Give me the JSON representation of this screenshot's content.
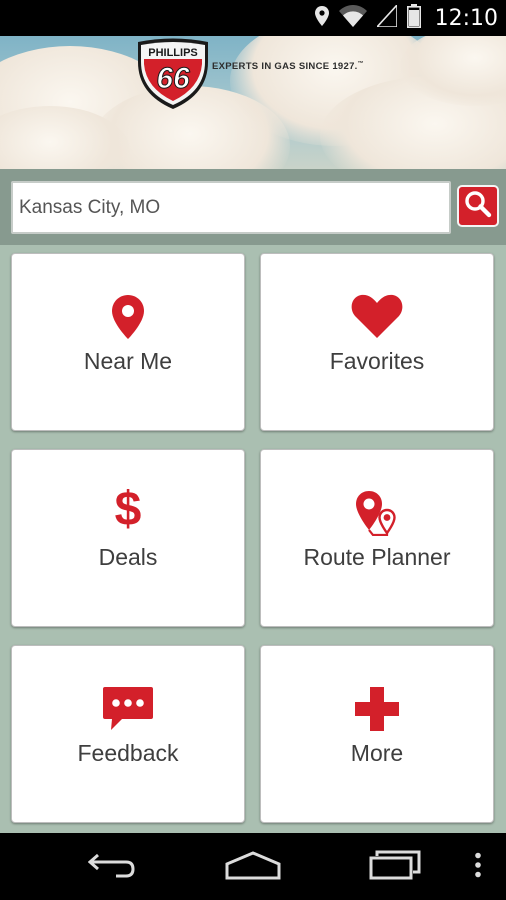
{
  "status_bar": {
    "time": "12:10",
    "icons": [
      "location-icon",
      "wifi-icon",
      "signal-icon",
      "battery-icon"
    ]
  },
  "header": {
    "brand_text": "PHILLIPS",
    "brand_number": "66",
    "tagline": "EXPERTS IN GAS SINCE 1927.",
    "tagline_mark": "™"
  },
  "search": {
    "value": "Kansas City, MO",
    "button_icon": "search-icon"
  },
  "tiles": [
    {
      "label": "Near Me",
      "icon": "map-pin-icon"
    },
    {
      "label": "Favorites",
      "icon": "heart-icon"
    },
    {
      "label": "Deals",
      "icon": "dollar-icon",
      "glyph": "$"
    },
    {
      "label": "Route Planner",
      "icon": "route-pins-icon"
    },
    {
      "label": "Feedback",
      "icon": "chat-bubble-icon"
    },
    {
      "label": "More",
      "icon": "plus-icon"
    }
  ],
  "nav_bar": {
    "buttons": [
      "back-icon",
      "home-icon",
      "recent-apps-icon",
      "overflow-menu-icon"
    ]
  },
  "colors": {
    "accent_red": "#d3202a",
    "search_band": "#879a8f",
    "grid_background": "#aabfb1",
    "tile_background": "#ffffff",
    "label_text": "#3e3e3e"
  }
}
